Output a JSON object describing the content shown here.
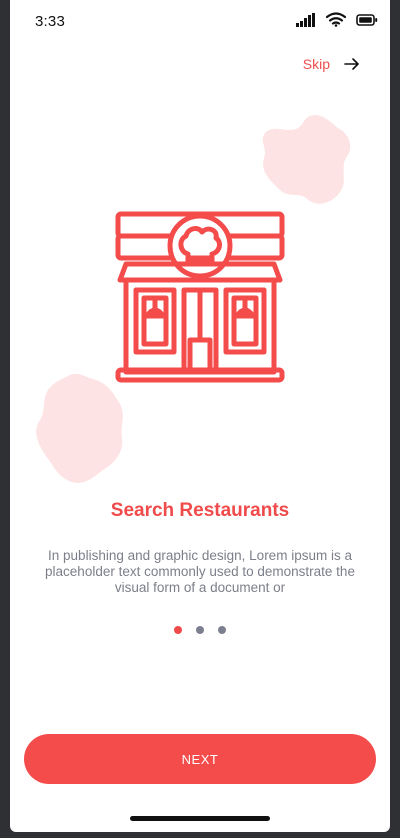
{
  "status_bar": {
    "time": "3:33",
    "icons": [
      "cellular-signal-icon",
      "wifi-icon",
      "battery-icon"
    ]
  },
  "header": {
    "skip_label": "Skip",
    "skip_icon": "arrow-right-icon"
  },
  "onboarding": {
    "illustration": "restaurant-storefront-icon",
    "title": "Search Restaurants",
    "description": "In publishing and graphic design, Lorem ipsum is a placeholder text commonly used to demonstrate the visual form of a document or",
    "pager": {
      "count": 3,
      "active_index": 0
    }
  },
  "footer": {
    "next_label": "NEXT"
  },
  "colors": {
    "accent": "#f44b4b",
    "blob": "#fde3e3",
    "text_muted": "#7c7f8a",
    "dot_inactive": "#7c7f8e"
  }
}
